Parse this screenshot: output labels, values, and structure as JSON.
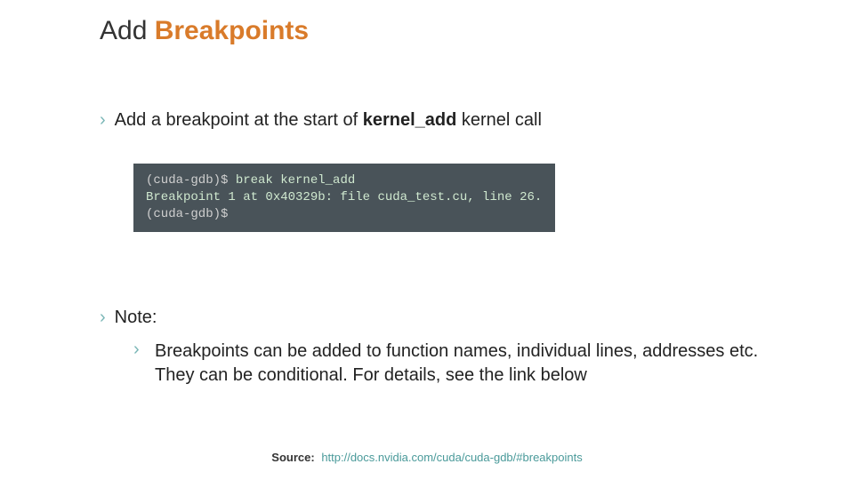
{
  "title": {
    "part1": "Add ",
    "part2": "Breakpoints"
  },
  "bullets": {
    "b1": {
      "pre": "Add a breakpoint at the start of ",
      "kern": "kernel_add",
      "post": " kernel call"
    },
    "note": "Note:",
    "b2": "Breakpoints can be added to function names, individual lines, addresses etc. They can be conditional. For details, see the link below"
  },
  "terminal": {
    "line1_prompt": "(cuda-gdb)$",
    "line1_cmd": " break kernel_add",
    "line2": "Breakpoint 1 at 0x40329b: file cuda_test.cu, line 26.",
    "line3_prompt": "(cuda-gdb)$"
  },
  "source": {
    "label": "Source:",
    "url": "http://docs.nvidia.com/cuda/cuda-gdb/#breakpoints"
  },
  "glyph": {
    "chevron": "›"
  }
}
